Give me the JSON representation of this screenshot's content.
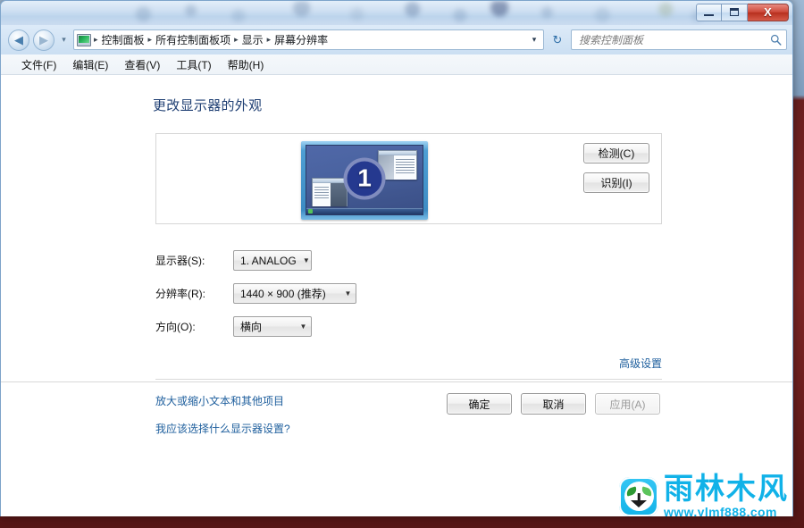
{
  "window": {
    "controls": {
      "minimize_label": "Minimize",
      "maximize_label": "Maximize",
      "close_label": "X"
    }
  },
  "navbar": {
    "back_glyph": "◀",
    "forward_glyph": "▶",
    "recent_glyph": "▾",
    "crumb_icon": "display-icon",
    "breadcrumbs": [
      {
        "label": "控制面板"
      },
      {
        "label": "所有控制面板项"
      },
      {
        "label": "显示"
      },
      {
        "label": "屏幕分辨率"
      }
    ],
    "separator": "▸",
    "dropdown_glyph": "▾",
    "refresh_glyph": "↻"
  },
  "search": {
    "placeholder": "搜索控制面板",
    "value": "",
    "icon": "ὐD"
  },
  "menubar": {
    "items": [
      {
        "label": "文件(F)"
      },
      {
        "label": "编辑(E)"
      },
      {
        "label": "查看(V)"
      },
      {
        "label": "工具(T)"
      },
      {
        "label": "帮助(H)"
      }
    ]
  },
  "main": {
    "page_title": "更改显示器的外观",
    "preview": {
      "monitor_number": "1",
      "detect_button": "检测(C)",
      "identify_button": "识别(I)"
    },
    "form": {
      "display_label": "显示器(S):",
      "display_value": "1. ANALOG",
      "resolution_label": "分辨率(R):",
      "resolution_value": "1440 × 900 (推荐)",
      "orientation_label": "方向(O):",
      "orientation_value": "横向",
      "arrow_glyph": "▼"
    },
    "links": {
      "advanced": "高级设置",
      "text_size": "放大或缩小文本和其他项目",
      "which_settings": "我应该选择什么显示器设置?"
    },
    "footer": {
      "ok": "确定",
      "cancel": "取消",
      "apply": "应用(A)"
    }
  },
  "watermark": {
    "title": "雨林木风",
    "url": "www.ylmf888.com"
  },
  "colors": {
    "accent_blue": "#11b2e8",
    "link_blue": "#20609e",
    "title_blue": "#1f3f73",
    "close_red": "#b7301f"
  }
}
